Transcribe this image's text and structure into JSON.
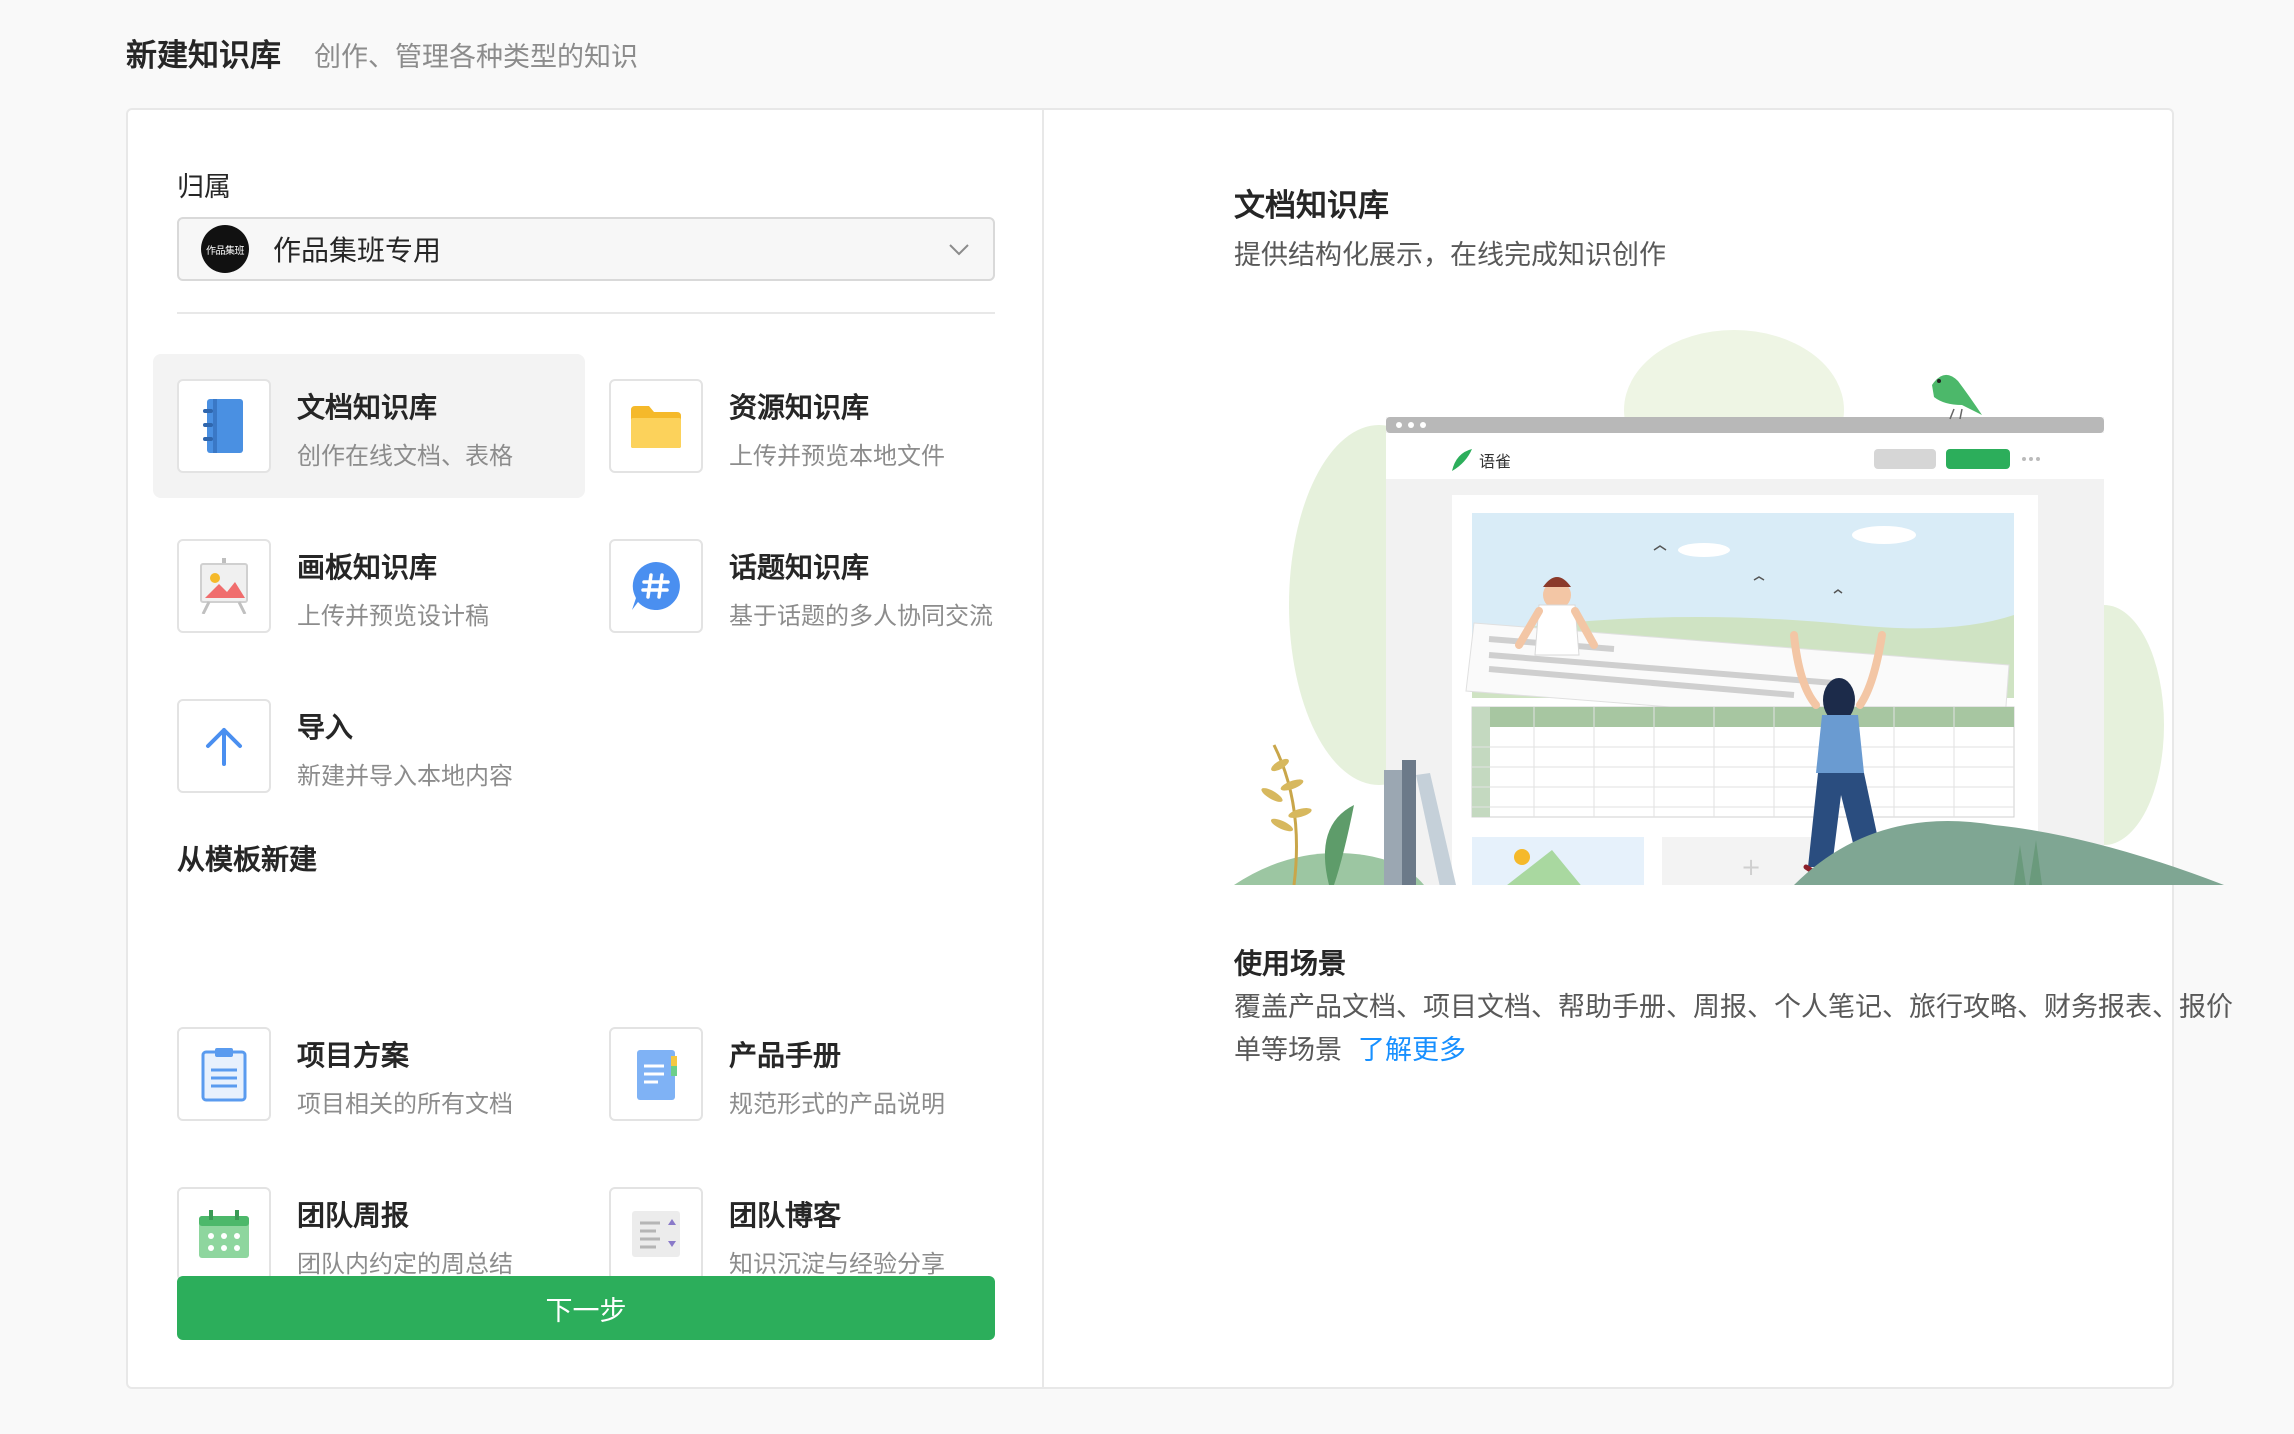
{
  "header": {
    "title": "新建知识库",
    "subtitle": "创作、管理各种类型的知识"
  },
  "owner": {
    "label": "归属",
    "avatar_text": "作品集班",
    "selected": "作品集班专用"
  },
  "types": [
    {
      "title": "文档知识库",
      "desc": "创作在线文档、表格",
      "icon": "notebook-icon",
      "selected": true
    },
    {
      "title": "资源知识库",
      "desc": "上传并预览本地文件",
      "icon": "folder-icon"
    },
    {
      "title": "画板知识库",
      "desc": "上传并预览设计稿",
      "icon": "easel-icon"
    },
    {
      "title": "话题知识库",
      "desc": "基于话题的多人协同交流",
      "icon": "hashtag-icon"
    },
    {
      "title": "导入",
      "desc": "新建并导入本地内容",
      "icon": "arrow-up-icon"
    }
  ],
  "template_section": {
    "label": "从模板新建",
    "items": [
      {
        "title": "项目方案",
        "desc": "项目相关的所有文档",
        "icon": "clipboard-icon"
      },
      {
        "title": "产品手册",
        "desc": "规范形式的产品说明",
        "icon": "manual-icon"
      },
      {
        "title": "团队周报",
        "desc": "团队内约定的周总结",
        "icon": "calendar-icon"
      },
      {
        "title": "团队博客",
        "desc": "知识沉淀与经验分享",
        "icon": "blog-icon"
      }
    ]
  },
  "next_button": "下一步",
  "preview": {
    "title": "文档知识库",
    "subtitle": "提供结构化展示，在线完成知识创作",
    "app_name": "语雀",
    "usage_title": "使用场景",
    "usage_text": "覆盖产品文档、项目文档、帮助手册、周报、个人笔记、旅行攻略、财务报表、报价单等场景",
    "learn_more": "了解更多"
  },
  "colors": {
    "primary": "#2cae5b",
    "link": "#1890ff",
    "text": "#262626",
    "muted": "#8c8c8c"
  }
}
